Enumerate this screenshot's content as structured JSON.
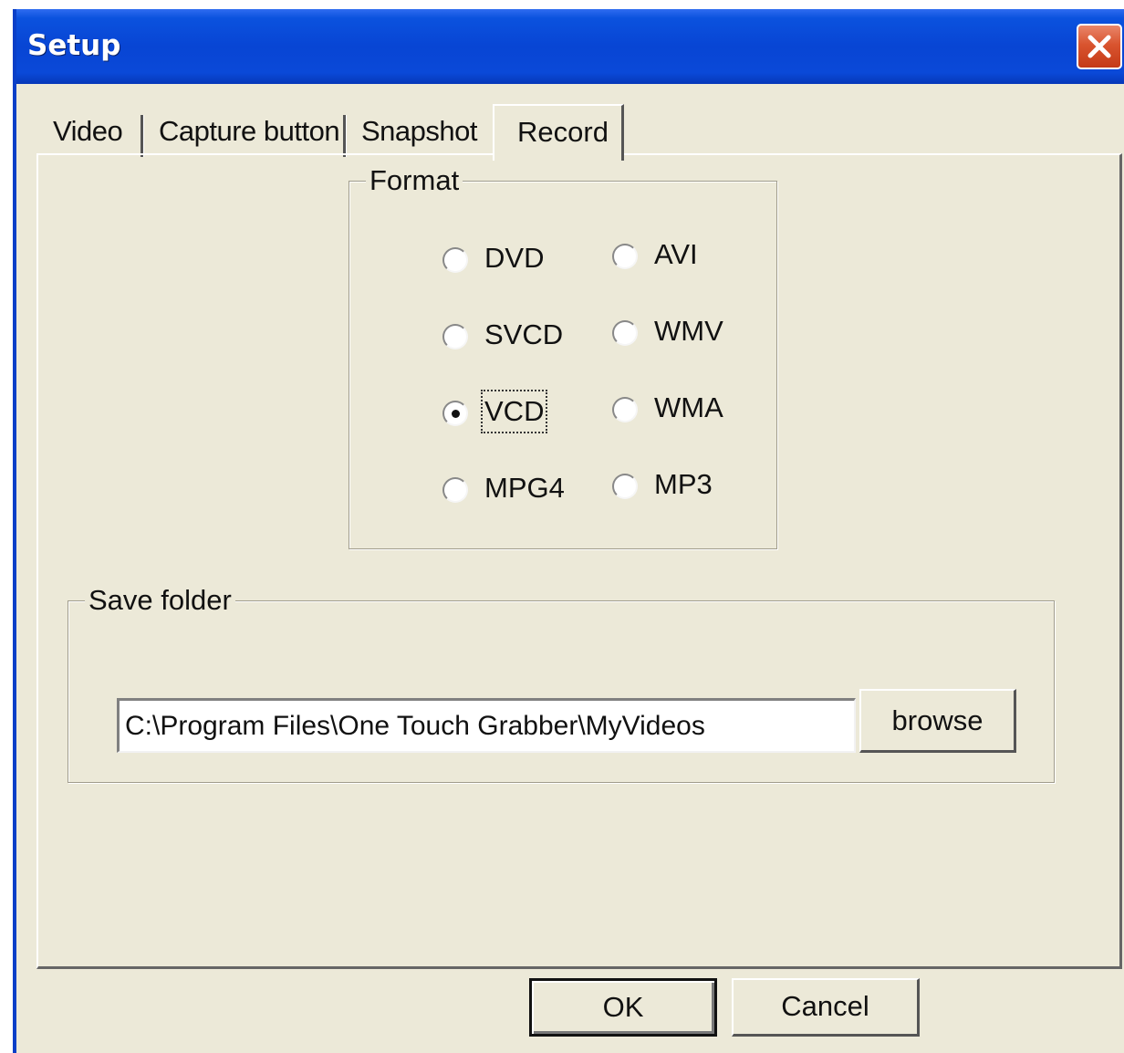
{
  "window": {
    "title": "Setup",
    "close_icon": "close-icon"
  },
  "tabs": [
    {
      "label": "Video",
      "active": false
    },
    {
      "label": "Capture button",
      "active": false
    },
    {
      "label": "Snapshot",
      "active": false
    },
    {
      "label": "Record",
      "active": true
    }
  ],
  "format": {
    "label": "Format",
    "options": [
      {
        "label": "DVD",
        "selected": false
      },
      {
        "label": "AVI",
        "selected": false
      },
      {
        "label": "SVCD",
        "selected": false
      },
      {
        "label": "WMV",
        "selected": false
      },
      {
        "label": "VCD",
        "selected": true
      },
      {
        "label": "WMA",
        "selected": false
      },
      {
        "label": "MPG4",
        "selected": false
      },
      {
        "label": "MP3",
        "selected": false
      }
    ]
  },
  "save_folder": {
    "label": "Save folder",
    "path": "C:\\Program Files\\One Touch Grabber\\MyVideos",
    "browse_label": "browse"
  },
  "footer": {
    "ok_label": "OK",
    "cancel_label": "Cancel"
  },
  "colors": {
    "title_bar": "#0A49D8",
    "dialog_bg": "#ECE9D8",
    "close_button": "#D9542F"
  }
}
